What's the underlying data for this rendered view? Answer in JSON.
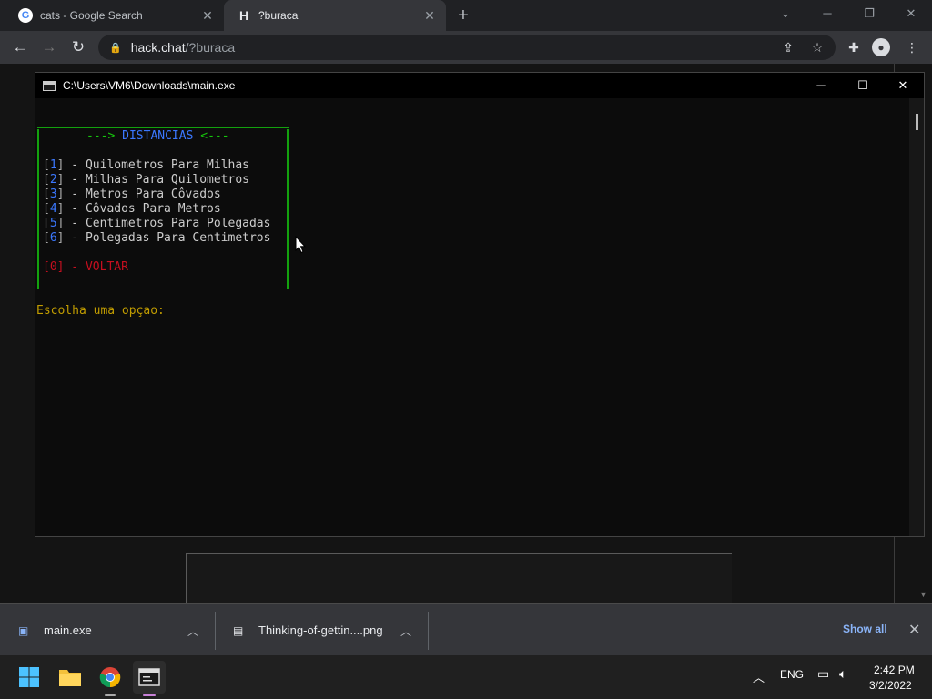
{
  "browser": {
    "tabs": [
      {
        "title": "cats - Google Search",
        "favicon": "G"
      },
      {
        "title": "?buraca",
        "favicon": "H"
      }
    ],
    "url_host": "hack.chat",
    "url_path": "/?buraca"
  },
  "console": {
    "title": "C:\\Users\\VM6\\Downloads\\main.exe",
    "header_prefix": "---> ",
    "header_title": "DISTANCIAS",
    "header_suffix": " <---",
    "items": [
      {
        "key": "1",
        "label": "Quilometros Para Milhas"
      },
      {
        "key": "2",
        "label": "Milhas Para Quilometros"
      },
      {
        "key": "3",
        "label": "Metros Para Côvados"
      },
      {
        "key": "4",
        "label": "Côvados Para Metros"
      },
      {
        "key": "5",
        "label": "Centimetros Para Polegadas"
      },
      {
        "key": "6",
        "label": "Polegadas Para Centimetros"
      }
    ],
    "exit_key": "0",
    "exit_label": "VOLTAR",
    "prompt": "Escolha uma opçao:"
  },
  "downloads": {
    "items": [
      {
        "name": "main.exe"
      },
      {
        "name": "Thinking-of-gettin....png"
      }
    ],
    "show_all": "Show all"
  },
  "taskbar": {
    "language": "ENG",
    "time": "2:42 PM",
    "date": "3/2/2022"
  },
  "colors": {
    "console_green": "#13a10e",
    "console_blue": "#3b78ff",
    "console_red": "#c50f1f",
    "console_yellow": "#c19c00",
    "link_blue": "#8ab4f8"
  }
}
